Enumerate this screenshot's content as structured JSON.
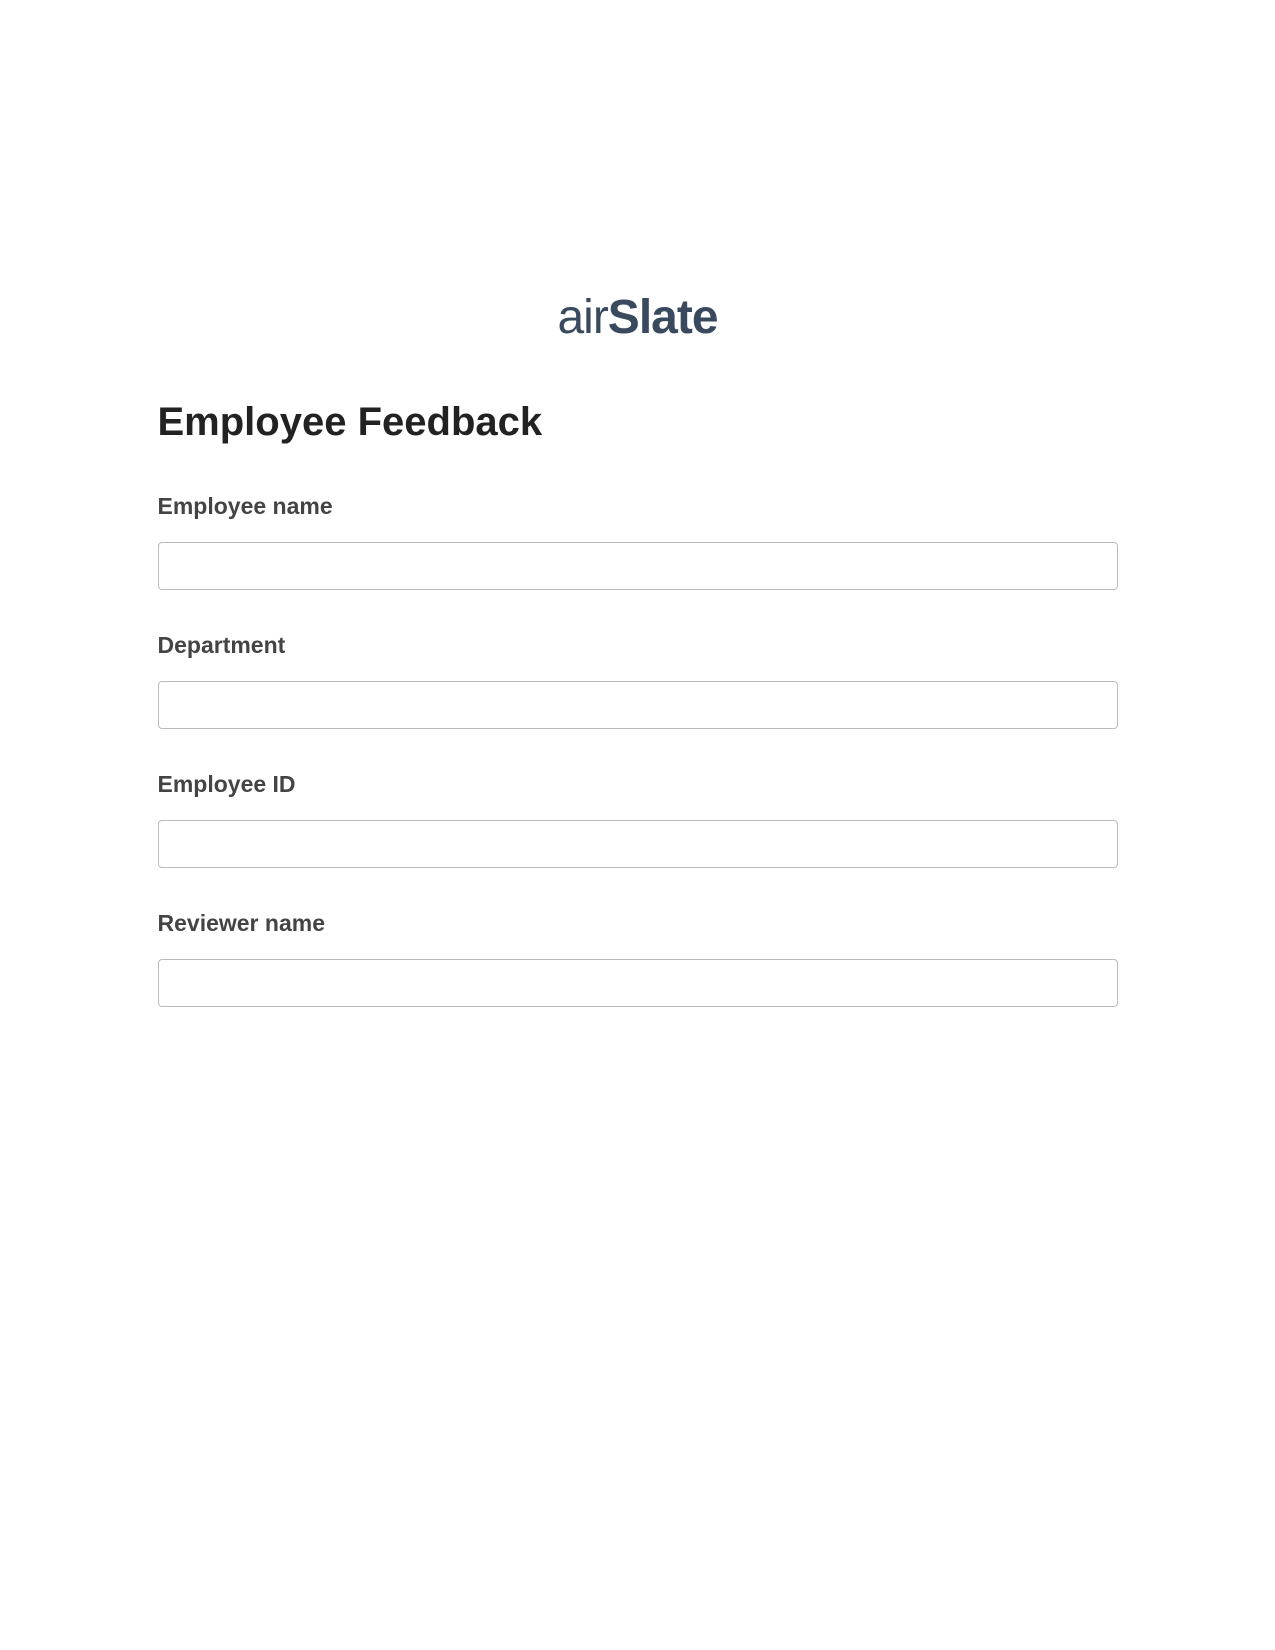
{
  "logo": {
    "part1": "air",
    "part2": "Slate"
  },
  "title": "Employee Feedback",
  "fields": [
    {
      "label": "Employee name",
      "value": ""
    },
    {
      "label": "Department",
      "value": ""
    },
    {
      "label": "Employee ID",
      "value": ""
    },
    {
      "label": "Reviewer name",
      "value": ""
    }
  ]
}
